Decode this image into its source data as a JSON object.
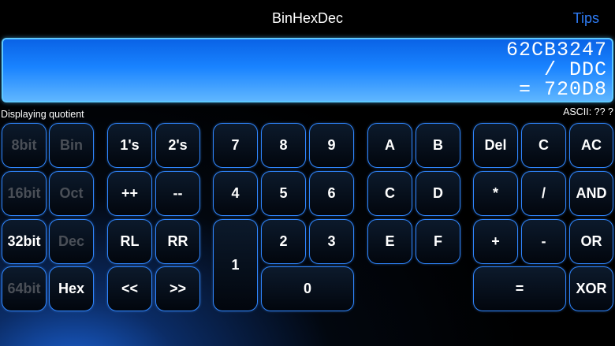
{
  "header": {
    "title": "BinHexDec",
    "tips_label": "Tips"
  },
  "display": {
    "line1": "62CB3247",
    "line2": "/ DDC",
    "line3": "= 720D8"
  },
  "status": {
    "message": "Displaying quotient",
    "ascii": "ASCII: ?? ?"
  },
  "keys": {
    "bits8": "8bit",
    "bits16": "16bit",
    "bits32": "32bit",
    "bits64": "64bit",
    "bin": "Bin",
    "oct": "Oct",
    "dec": "Dec",
    "hex": "Hex",
    "ones_comp": "1's",
    "twos_comp": "2's",
    "increment": "++",
    "decrement": "--",
    "rotate_left": "RL",
    "rotate_right": "RR",
    "shift_left": "<<",
    "shift_right": ">>",
    "d7": "7",
    "d8": "8",
    "d9": "9",
    "d4": "4",
    "d5": "5",
    "d6": "6",
    "d1": "1",
    "d2": "2",
    "d3": "3",
    "d0": "0",
    "hA": "A",
    "hB": "B",
    "hC": "C",
    "hD": "D",
    "hE": "E",
    "hF": "F",
    "del": "Del",
    "clear": "C",
    "all_clear": "AC",
    "multiply": "*",
    "divide": "/",
    "and": "AND",
    "plus": "+",
    "minus": "-",
    "or": "OR",
    "equals": "=",
    "xor": "XOR"
  },
  "colors": {
    "accent": "#2e7cf6",
    "key_border": "#2f86ff",
    "display_top": "#0a63e6",
    "display_bottom": "#5fb6ff",
    "dim_text": "#4a4f57"
  }
}
